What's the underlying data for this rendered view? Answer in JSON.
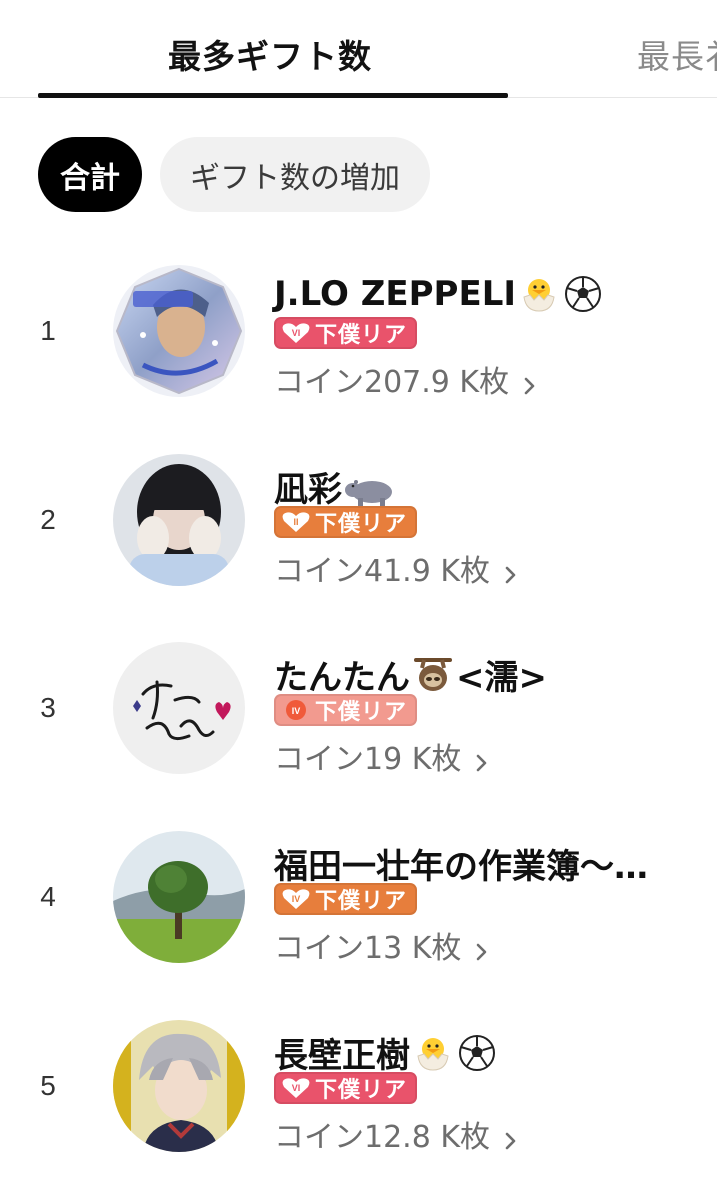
{
  "tabs": {
    "active": "最多ギフト数",
    "next": "最長衤"
  },
  "filters": {
    "total": "合計",
    "increase": "ギフト数の増加"
  },
  "ranking": [
    {
      "rank": "1",
      "name": "J.LO ZEPPELI",
      "emojis": [
        "hatching-chick-icon",
        "soccer-ball-icon"
      ],
      "badge_level": "VI",
      "badge_label": "下僕リア",
      "badge_color": "#e9536b",
      "coins": "コイン207.9 K枚"
    },
    {
      "rank": "2",
      "name": "凪彩",
      "emojis": [
        "hippo-icon"
      ],
      "badge_level": "II",
      "badge_label": "下僕リア",
      "badge_color": "#e77e3c",
      "coins": "コイン41.9 K枚"
    },
    {
      "rank": "3",
      "name": "たんたん",
      "name_suffix": "<濡>",
      "emojis": [
        "sloth-icon"
      ],
      "badge_level": "IV",
      "badge_label": "下僕リア",
      "badge_color": "#f29a8f",
      "coins": "コイン19 K枚"
    },
    {
      "rank": "4",
      "name": "福田一壮年の作業簿〜…",
      "emojis": [],
      "badge_level": "IV",
      "badge_label": "下僕リア",
      "badge_color": "#e77e3c",
      "coins": "コイン13 K枚"
    },
    {
      "rank": "5",
      "name": "長壁正樹",
      "emojis": [
        "hatching-chick-icon",
        "soccer-ball-icon"
      ],
      "badge_level": "VI",
      "badge_label": "下僕リア",
      "badge_color": "#e9536b",
      "coins": "コイン12.8 K枚"
    }
  ]
}
